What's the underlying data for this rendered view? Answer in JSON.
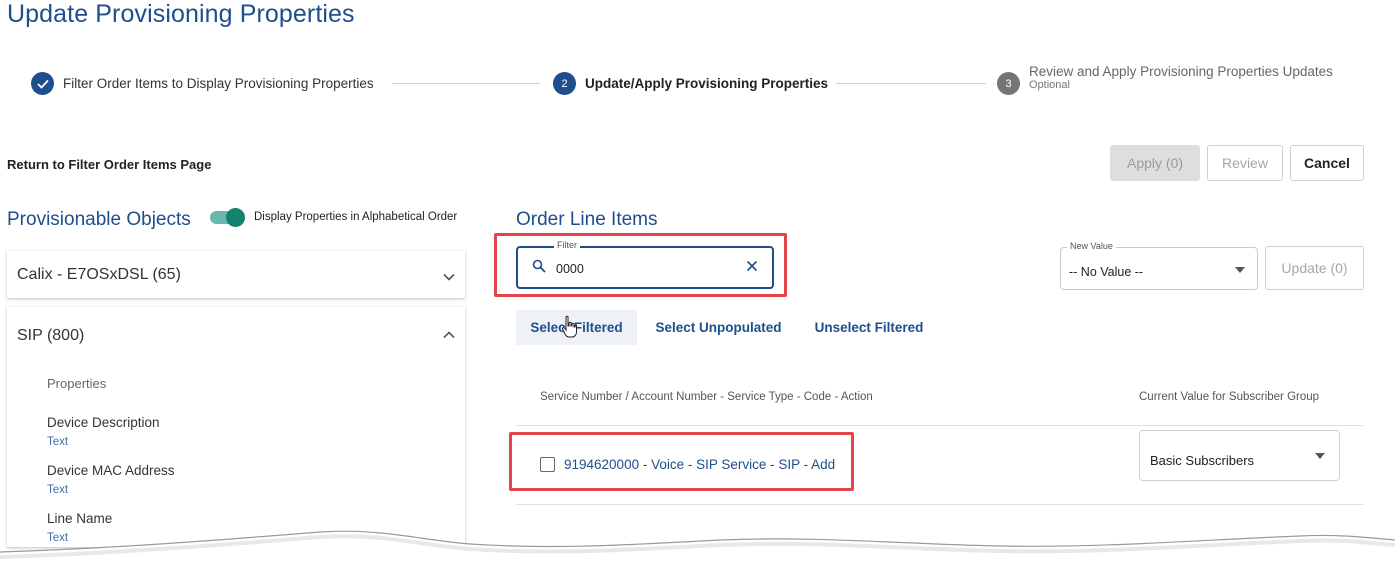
{
  "page_title": "Update Provisioning Properties",
  "stepper": {
    "steps": [
      {
        "number": "",
        "label": "Filter Order Items to Display Provisioning Properties",
        "state": "done"
      },
      {
        "number": "2",
        "label": "Update/Apply Provisioning Properties",
        "state": "active"
      },
      {
        "number": "3",
        "label": "Review and Apply Provisioning Properties Updates",
        "sub": "Optional",
        "state": "pending"
      }
    ]
  },
  "return_link": "Return to Filter Order Items Page",
  "toolbar": {
    "apply_label": "Apply (0)",
    "review_label": "Review",
    "cancel_label": "Cancel"
  },
  "left_panel": {
    "title": "Provisionable Objects",
    "toggle_label": "Display Properties in Alphabetical Order",
    "toggle_on": true,
    "objects": [
      {
        "label": "Calix - E7OSxDSL (65)",
        "expanded": false
      },
      {
        "label": "SIP (800)",
        "expanded": true
      }
    ],
    "properties_heading": "Properties",
    "properties": [
      {
        "name": "Device Description",
        "type": "Text"
      },
      {
        "name": "Device MAC Address",
        "type": "Text"
      },
      {
        "name": "Line Name",
        "type": "Text"
      }
    ]
  },
  "right_panel": {
    "title": "Order Line Items",
    "filter": {
      "legend": "Filter",
      "value": "0000"
    },
    "new_value": {
      "legend": "New Value",
      "value": "-- No Value --"
    },
    "update_label": "Update (0)",
    "actions": {
      "select_filtered": "Select Filtered",
      "select_unpopulated": "Select Unpopulated",
      "unselect_filtered": "Unselect Filtered"
    },
    "columns": {
      "service": "Service Number / Account Number - Service Type - Code - Action",
      "current_value": "Current Value for Subscriber Group"
    },
    "rows": [
      {
        "label": "9194620000 - Voice - SIP Service - SIP - Add",
        "checked": false,
        "current_value": "Basic Subscribers"
      }
    ]
  },
  "colors": {
    "primary": "#1f4e8c",
    "highlight": "#e0454b",
    "toggle": "#14826f"
  }
}
